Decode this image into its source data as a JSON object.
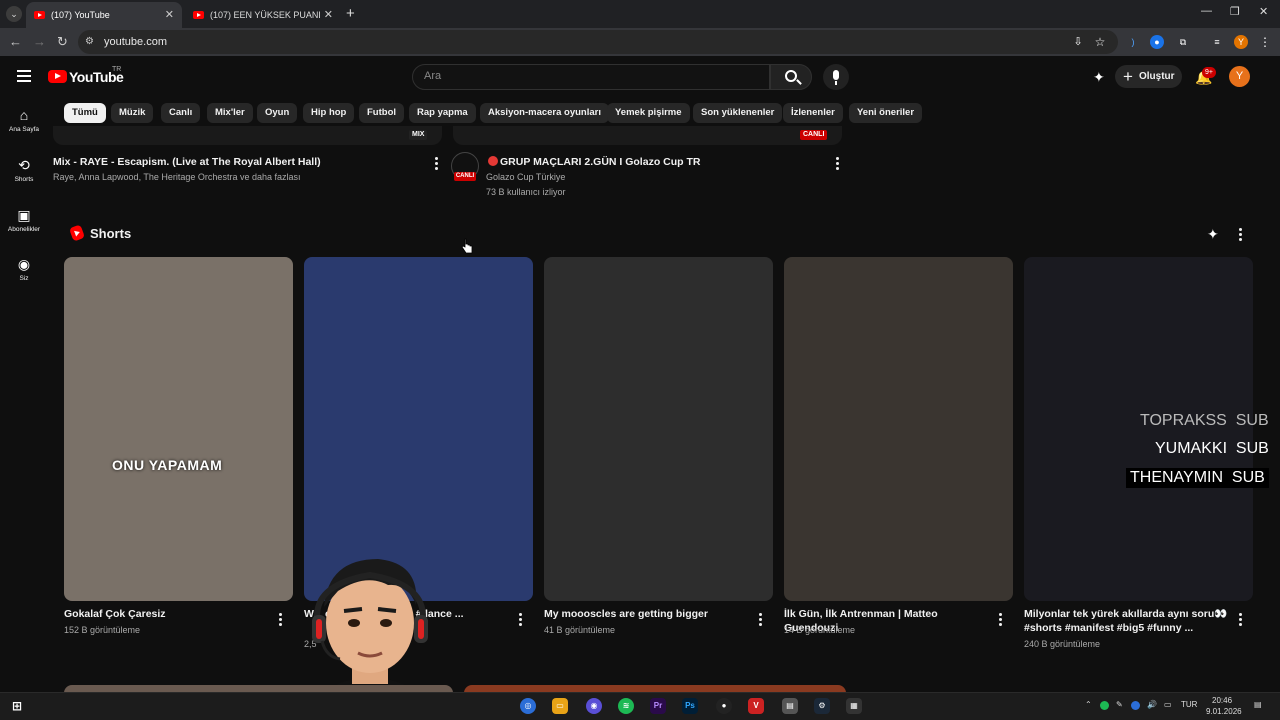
{
  "browser": {
    "tabs": [
      {
        "label": "(107) YouTube",
        "active": true
      },
      {
        "label": "(107) EEN YÜKSEK PUANLI RES",
        "active": false
      }
    ],
    "url": "youtube.com"
  },
  "header": {
    "logo_text": "YouTube",
    "country": "TR",
    "search_placeholder": "Ara",
    "create_label": "Oluştur",
    "notification_badge": "9+",
    "avatar_letter": "Y"
  },
  "chips": [
    "Tümü",
    "Müzik",
    "Canlı",
    "Mix'ler",
    "Oyun",
    "Hip hop",
    "Futbol",
    "Rap yapma",
    "Aksiyon-macera oyunları",
    "Yemek pişirme",
    "Son yüklenenler",
    "İzlenenler",
    "Yeni öneriler"
  ],
  "sidebar": [
    {
      "label": "Ana Sayfa",
      "icon": "home-icon"
    },
    {
      "label": "Shorts",
      "icon": "shorts-icon"
    },
    {
      "label": "Abonelikler",
      "icon": "subscriptions-icon"
    },
    {
      "label": "Siz",
      "icon": "you-icon"
    }
  ],
  "top_videos": [
    {
      "badge": "MIX",
      "title": "Mix - RAYE - Escapism. (Live at The Royal Albert Hall)",
      "meta": "Raye, Anna Lapwood, The Heritage Orchestra ve daha fazlası"
    },
    {
      "badge": "CANLI",
      "channel_badge": "CANLI",
      "title": "GRUP MAÇLARI 2.GÜN I Golazo Cup TR",
      "channel": "Golazo Cup Türkiye",
      "meta": "73 B kullanıcı izliyor"
    }
  ],
  "shorts": {
    "title": "Shorts",
    "items": [
      {
        "title": "Gokalaf Çok Çaresiz",
        "views": "152 B görüntüleme",
        "overlay": "ONU YAPAMAM",
        "bg": "#7a7168"
      },
      {
        "title": "W... ce floor🏁 #... eur #dance ...",
        "views": "2,5",
        "overlay": "",
        "bg": "#2a3a6e"
      },
      {
        "title": "My moooscles are getting bigger",
        "views": "41 B görüntüleme",
        "overlay": "",
        "bg": "#2d2d2d"
      },
      {
        "title": "İlk Gün, İlk Antrenman | Matteo Guendouzi",
        "views": "14 B görüntüleme",
        "overlay": "",
        "bg": "#3a3530"
      },
      {
        "title": "Milyonlar tek yürek akıllarda aynı soru👀 #shorts #manifest #big5 #funny ...",
        "views": "240 B görüntüleme",
        "overlay": "",
        "bg": "#1a1a20",
        "subs": [
          "TOPRAKSS  SUB",
          "YUMAKKI  SUB",
          "THENAYMIN  SUB"
        ]
      }
    ]
  },
  "taskbar": {
    "lang": "TUR",
    "time": "20:46",
    "date": "9.01.2026"
  },
  "colors": {
    "accent": "#ff0000",
    "background": "#0f0f0f",
    "chip": "#272727"
  }
}
